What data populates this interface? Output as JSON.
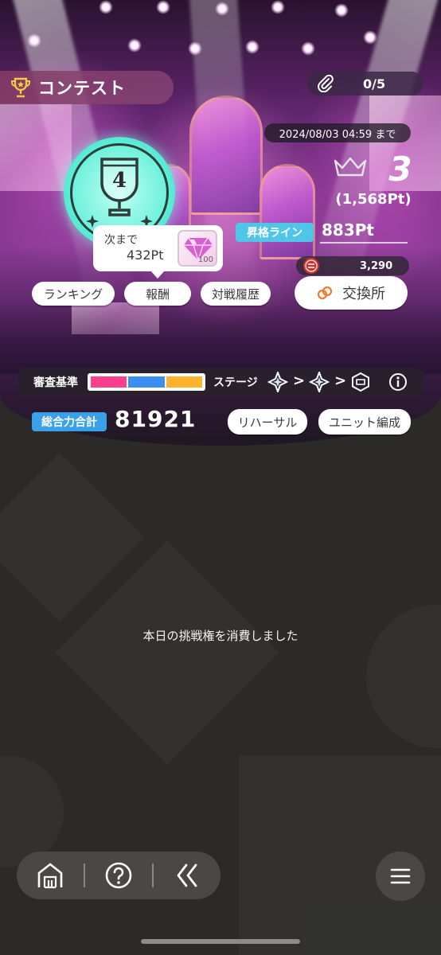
{
  "header": {
    "title": "コンテスト",
    "tickets": "0/5",
    "deadline": "2024/08/03 04:59 まで"
  },
  "rank": {
    "position": "3",
    "points": "(1,568Pt)"
  },
  "grade": {
    "number": "4",
    "next_label": "次まで",
    "next_points": "432Pt",
    "reward_qty": "100"
  },
  "promotion": {
    "label": "昇格ライン",
    "value": "883Pt"
  },
  "buttons": {
    "ranking": "ランキング",
    "reward": "報酬",
    "history": "対戦履歴",
    "exchange": "交換所",
    "rehearsal": "リハーサル",
    "unit": "ユニット編成"
  },
  "exchange": {
    "coins": "3,290"
  },
  "criteria": {
    "label": "審査基準",
    "colors": [
      "#ff3f8e",
      "#3b8ff0",
      "#ffb22e"
    ],
    "stage_label": "ステージ"
  },
  "power": {
    "label": "総合力合計",
    "value": "81921"
  },
  "notice": "本日の挑戦権を消費しました",
  "nav": {
    "icons": [
      "home-icon",
      "help-icon",
      "back-icon",
      "menu-icon"
    ]
  }
}
